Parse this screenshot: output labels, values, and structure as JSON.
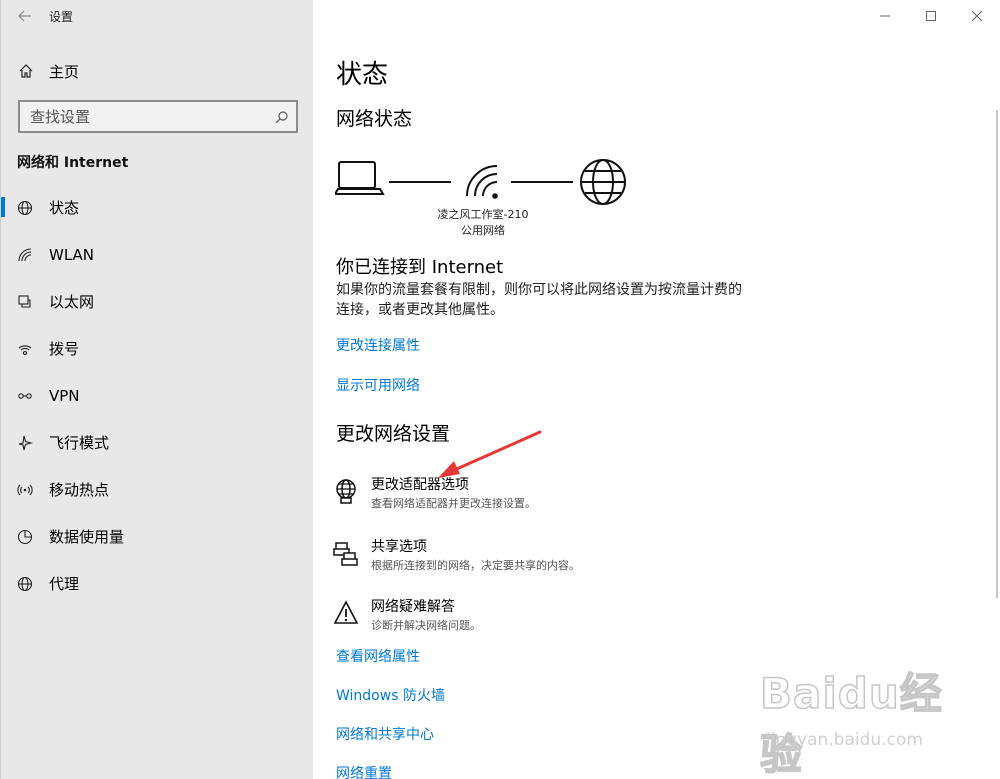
{
  "titlebar": {
    "title": "设置"
  },
  "sidebar": {
    "home_label": "主页",
    "search_placeholder": "查找设置",
    "section_title": "网络和 Internet",
    "items": [
      {
        "label": "状态",
        "icon": "globe-icon",
        "active": true
      },
      {
        "label": "WLAN",
        "icon": "wifi-icon"
      },
      {
        "label": "以太网",
        "icon": "ethernet-icon"
      },
      {
        "label": "拨号",
        "icon": "dialup-icon"
      },
      {
        "label": "VPN",
        "icon": "vpn-icon"
      },
      {
        "label": "飞行模式",
        "icon": "airplane-icon"
      },
      {
        "label": "移动热点",
        "icon": "hotspot-icon"
      },
      {
        "label": "数据使用量",
        "icon": "data-usage-icon"
      },
      {
        "label": "代理",
        "icon": "proxy-icon"
      }
    ]
  },
  "main": {
    "title": "状态",
    "network_status_heading": "网络状态",
    "network_name": "凌之风工作室-210",
    "network_type": "公用网络",
    "connected_heading": "你已连接到 Internet",
    "connected_desc": "如果你的流量套餐有限制，则你可以将此网络设置为按流量计费的连接，或者更改其他属性。",
    "links_top": [
      "更改连接属性",
      "显示可用网络"
    ],
    "change_heading": "更改网络设置",
    "options": [
      {
        "title": "更改适配器选项",
        "subtitle": "查看网络适配器并更改连接设置。",
        "icon": "adapter-icon"
      },
      {
        "title": "共享选项",
        "subtitle": "根据所连接到的网络，决定要共享的内容。",
        "icon": "sharing-icon"
      },
      {
        "title": "网络疑难解答",
        "subtitle": "诊断并解决网络问题。",
        "icon": "warning-icon"
      }
    ],
    "links_bottom": [
      "查看网络属性",
      "Windows 防火墙",
      "网络和共享中心",
      "网络重置"
    ]
  },
  "watermark": {
    "logo": "Baidu经验",
    "url": "jingyan.baidu.com"
  },
  "colors": {
    "accent": "#0078d7",
    "sidebar_bg": "#e8e8e8",
    "arrow": "#e53935"
  }
}
